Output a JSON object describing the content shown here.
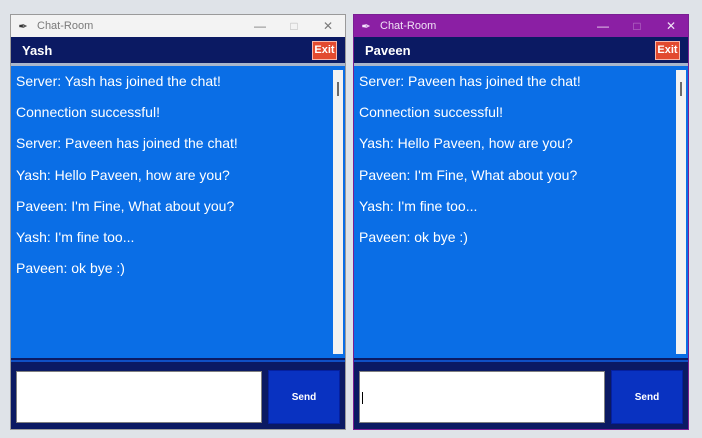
{
  "windows": [
    {
      "title": "Chat-Room",
      "username": "Yash",
      "exit_label": "Exit",
      "messages": [
        "Server: Yash has joined the chat!",
        "Connection successful!",
        "Server: Paveen has joined the chat!",
        "Yash: Hello Paveen, how are you?",
        "Paveen: I'm Fine, What about you?",
        "Yash: I'm fine too...",
        "Paveen: ok bye :)"
      ],
      "input_value": "",
      "send_label": "Send"
    },
    {
      "title": "Chat-Room",
      "username": "Paveen",
      "exit_label": "Exit",
      "messages": [
        "Server: Paveen has joined the chat!",
        "Connection successful!",
        "Yash: Hello Paveen, how are you?",
        "Paveen: I'm Fine, What about you?",
        "Yash: I'm fine too...",
        "Paveen: ok bye :)"
      ],
      "input_value": "",
      "send_label": "Send"
    }
  ],
  "icons": {
    "app": "feather-icon",
    "minimize": "minimize-icon",
    "maximize": "maximize-icon",
    "close": "close-icon"
  },
  "colors": {
    "chat_background": "#0a6ee6",
    "header_background": "#0b1a63",
    "exit_button": "#e24a2f",
    "send_button": "#0932c1",
    "active_titlebar": "#8b1fa4"
  }
}
